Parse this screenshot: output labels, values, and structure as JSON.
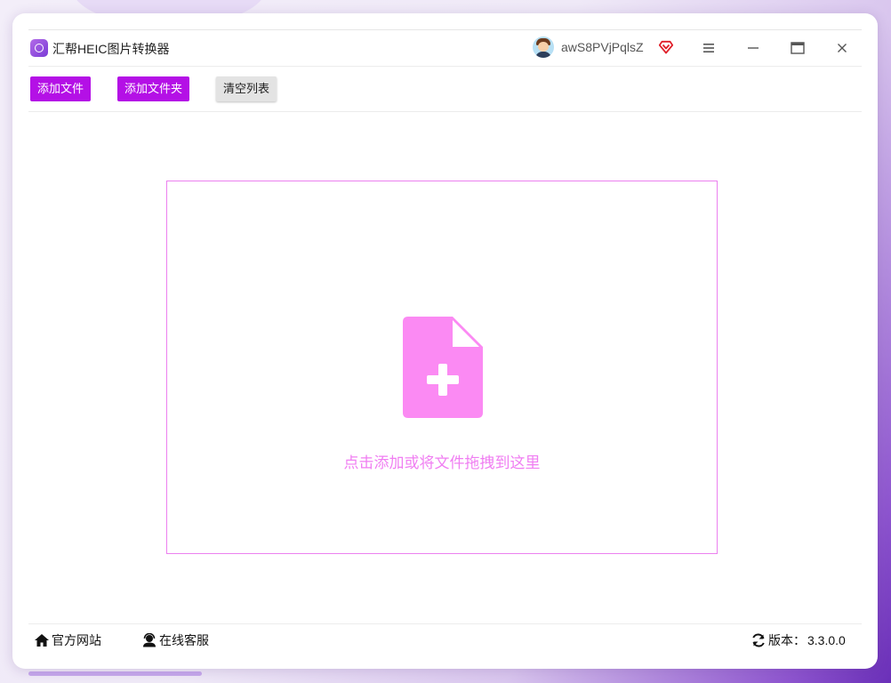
{
  "window": {
    "title": "汇帮HEIC图片转换器",
    "username": "awS8PVjPqlsZ"
  },
  "toolbar": {
    "add_file": "添加文件",
    "add_folder": "添加文件夹",
    "clear_list": "清空列表"
  },
  "dropzone": {
    "hint": "点击添加或将文件拖拽到这里",
    "icon": "file-add-icon"
  },
  "statusbar": {
    "website": "官方网站",
    "support": "在线客服",
    "version_label": "版本：",
    "version_value": "3.3.0.0"
  },
  "colors": {
    "accent": "#b410e6",
    "dropzone_border": "#ec80ef",
    "dropzone_icon": "#fb8af3",
    "vip": "#e0202a"
  }
}
